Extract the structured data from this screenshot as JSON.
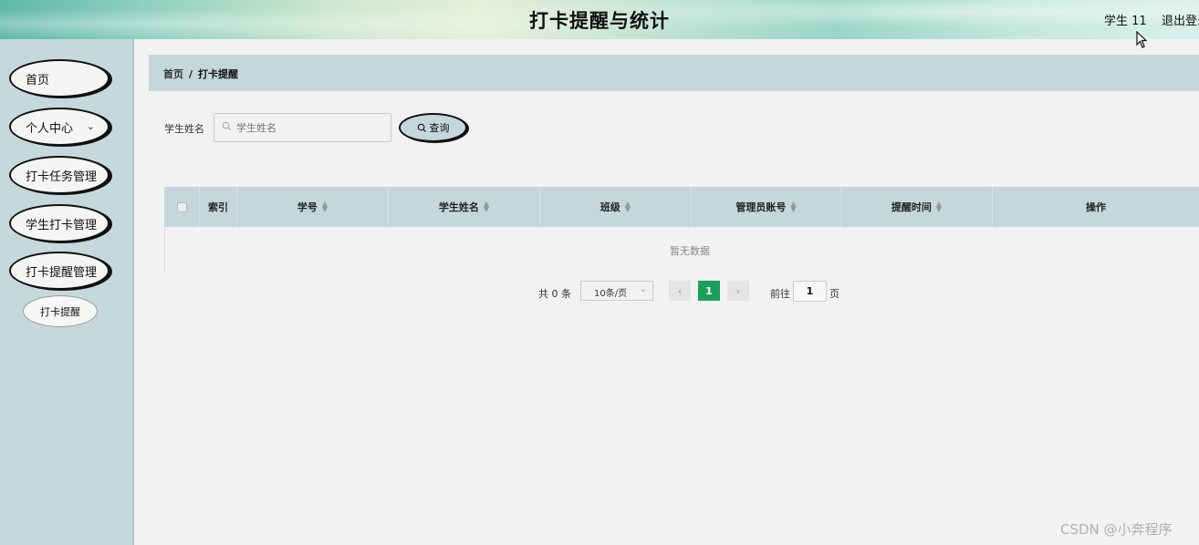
{
  "header": {
    "title": "打卡提醒与统计",
    "user": "学生 11",
    "logout": "退出登录"
  },
  "sidebar": {
    "items": [
      {
        "label": "首页"
      },
      {
        "label": "个人中心",
        "chevron": "⌄"
      },
      {
        "label": "打卡任务管理"
      },
      {
        "label": "学生打卡管理"
      },
      {
        "label": "打卡提醒管理"
      }
    ],
    "subitem": "打卡提醒"
  },
  "breadcrumb": {
    "home": "首页",
    "separator": "/",
    "current": "打卡提醒"
  },
  "search": {
    "label": "学生姓名",
    "placeholder": "学生姓名",
    "value": "",
    "button": "查询"
  },
  "table": {
    "columns": [
      "索引",
      "学号",
      "学生姓名",
      "班级",
      "管理员账号",
      "提醒时间",
      "操作"
    ],
    "empty_text": "暂无数据"
  },
  "pagination": {
    "total": "共 0 条",
    "page_size": "10条/页",
    "current_page": "1",
    "goto_label": "前往",
    "goto_value": "1",
    "page_unit": "页"
  },
  "watermark": "CSDN @小奔程序",
  "colors": {
    "sidebar_bg": "#c5d9dd",
    "table_head_bg": "#c4d7da",
    "active_page": "#1aa05a"
  }
}
